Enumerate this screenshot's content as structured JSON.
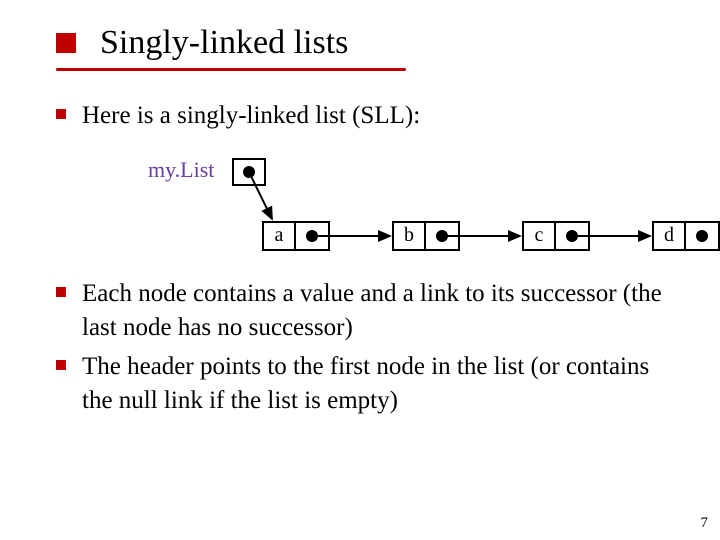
{
  "title": "Singly-linked lists",
  "bullets": {
    "intro": "Here is a singly-linked list (SLL):",
    "second": "Each node contains a value and a link to its successor (the last node has no successor)",
    "third": "The header points to the first node in the list (or contains the null link if the list is empty)"
  },
  "diagram": {
    "header_label": "my.List",
    "nodes": [
      "a",
      "b",
      "c",
      "d"
    ]
  },
  "page_number": "7"
}
